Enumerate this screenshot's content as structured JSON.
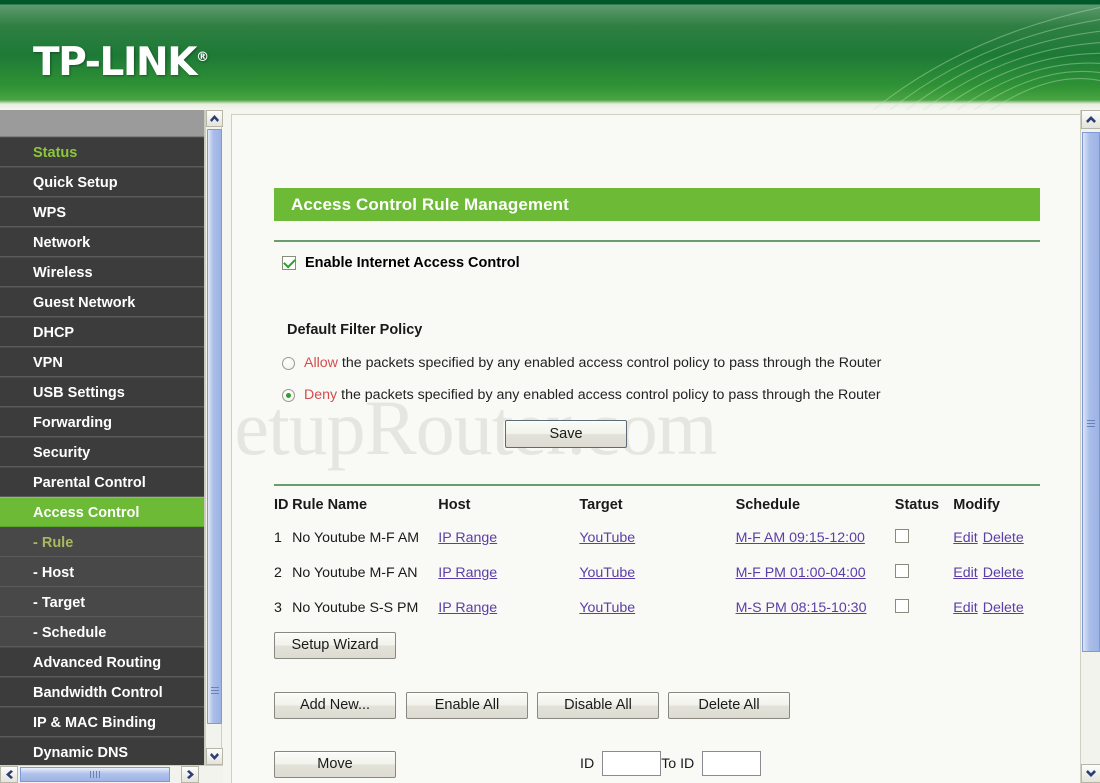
{
  "brand": {
    "name": "TP-LINK",
    "registered_mark": "®"
  },
  "sidebar": {
    "items": [
      {
        "label": "Status",
        "state": "active-text"
      },
      {
        "label": "Quick Setup",
        "state": "normal"
      },
      {
        "label": "WPS",
        "state": "normal"
      },
      {
        "label": "Network",
        "state": "normal"
      },
      {
        "label": "Wireless",
        "state": "normal"
      },
      {
        "label": "Guest Network",
        "state": "normal"
      },
      {
        "label": "DHCP",
        "state": "normal"
      },
      {
        "label": "VPN",
        "state": "normal"
      },
      {
        "label": "USB Settings",
        "state": "normal"
      },
      {
        "label": "Forwarding",
        "state": "normal"
      },
      {
        "label": "Security",
        "state": "normal"
      },
      {
        "label": "Parental Control",
        "state": "normal"
      },
      {
        "label": "Access Control",
        "state": "selected"
      },
      {
        "label": "- Rule",
        "state": "sub-active"
      },
      {
        "label": "- Host",
        "state": "sub"
      },
      {
        "label": "- Target",
        "state": "sub"
      },
      {
        "label": "- Schedule",
        "state": "sub"
      },
      {
        "label": "Advanced Routing",
        "state": "normal"
      },
      {
        "label": "Bandwidth Control",
        "state": "normal"
      },
      {
        "label": "IP & MAC Binding",
        "state": "normal"
      },
      {
        "label": "Dynamic DNS",
        "state": "normal"
      }
    ]
  },
  "main": {
    "page_title": "Access Control Rule Management",
    "watermark": "SetupRouter.com",
    "enable_checkbox": {
      "label": "Enable Internet Access Control",
      "checked": true
    },
    "filter_policy": {
      "heading": "Default Filter Policy",
      "options": [
        {
          "keyword": "Allow",
          "text": "the packets specified by any enabled access control policy to pass through the Router",
          "selected": false
        },
        {
          "keyword": "Deny",
          "text": "the packets specified by any enabled access control policy to pass through the Router",
          "selected": true
        }
      ]
    },
    "save_label": "Save",
    "table": {
      "headers": [
        "ID",
        "Rule Name",
        "Host",
        "Target",
        "Schedule",
        "Status",
        "Modify"
      ],
      "rows": [
        {
          "id": "1",
          "rule_name": "No Youtube M-F AM",
          "host": "IP Range",
          "target": "YouTube",
          "schedule": "M-F AM 09:15-12:00",
          "status_checked": false,
          "edit": "Edit",
          "delete": "Delete"
        },
        {
          "id": "2",
          "rule_name": "No Youtube M-F AN",
          "host": "IP Range",
          "target": "YouTube",
          "schedule": "M-F PM 01:00-04:00",
          "status_checked": false,
          "edit": "Edit",
          "delete": "Delete"
        },
        {
          "id": "3",
          "rule_name": "No Youtube S-S PM",
          "host": "IP Range",
          "target": "YouTube",
          "schedule": "M-S PM 08:15-10:30",
          "status_checked": false,
          "edit": "Edit",
          "delete": "Delete"
        }
      ]
    },
    "buttons": {
      "setup_wizard": "Setup Wizard",
      "add_new": "Add New...",
      "enable_all": "Enable All",
      "disable_all": "Disable All",
      "delete_all": "Delete All",
      "move": "Move"
    },
    "move_row": {
      "id_label": "ID",
      "id_value": "",
      "to_id_label": "To ID",
      "to_id_value": ""
    }
  },
  "colors": {
    "brand_green": "#6cba35",
    "header_green_dark": "#00582b",
    "sidebar_dark": "#3c3c3c",
    "link_purple": "#5b3ea8",
    "emphasis_red": "#d34d4d",
    "scrollbar_blue": "#9cb3e4"
  }
}
